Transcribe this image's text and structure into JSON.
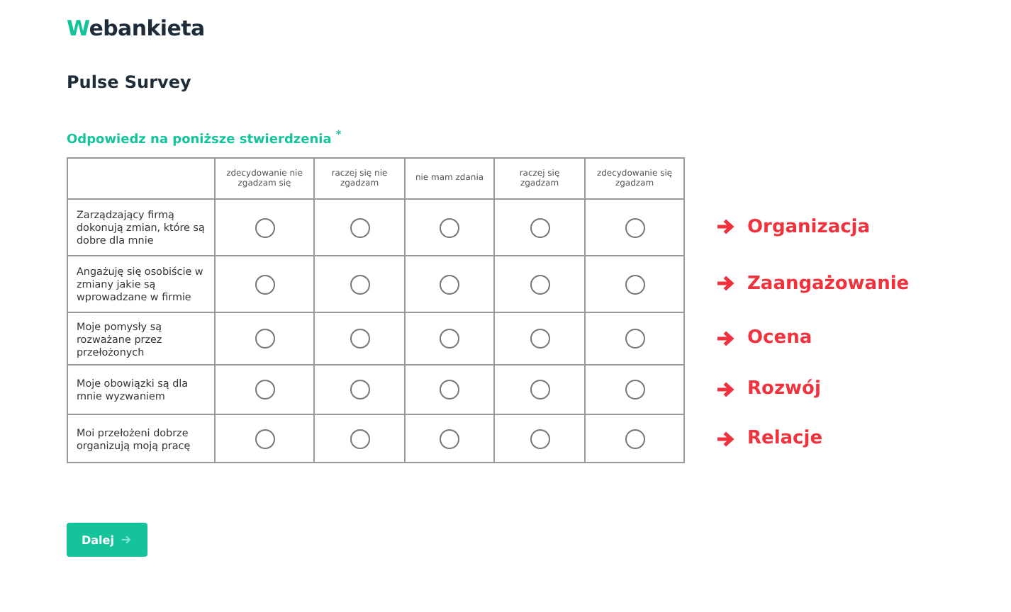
{
  "logo": "Webankieta",
  "title": "Pulse Survey",
  "question": {
    "text": "Odpowiedz na poniższe stwierdzenia",
    "required_mark": "*"
  },
  "table": {
    "columns": [
      "zdecydowanie nie zgadzam się",
      "raczej się nie zgadzam",
      "nie mam zdania",
      "raczej się zgadzam",
      "zdecydowanie się zgadzam"
    ],
    "rows": [
      {
        "statement": "Zarządzający firmą dokonują zmian, które są dobre dla mnie",
        "category": "Organizacja",
        "options": [
          {
            "selected": false
          },
          {
            "selected": false
          },
          {
            "selected": false
          },
          {
            "selected": false
          },
          {
            "selected": false
          }
        ]
      },
      {
        "statement": "Angażuję się osobiście w zmiany jakie są wprowadzane w firmie",
        "category": "Zaangażowanie",
        "options": [
          {
            "selected": false
          },
          {
            "selected": false
          },
          {
            "selected": false
          },
          {
            "selected": false
          },
          {
            "selected": false
          }
        ]
      },
      {
        "statement": "Moje pomysły są rozważane przez przełożonych",
        "category": "Ocena",
        "options": [
          {
            "selected": false
          },
          {
            "selected": false
          },
          {
            "selected": false
          },
          {
            "selected": false
          },
          {
            "selected": false
          }
        ]
      },
      {
        "statement": "Moje obowiązki są dla mnie wyzwaniem",
        "category": "Rozwój",
        "options": [
          {
            "selected": false
          },
          {
            "selected": false
          },
          {
            "selected": false
          },
          {
            "selected": false
          },
          {
            "selected": false
          }
        ]
      },
      {
        "statement": "Moi przełożeni dobrze organizują moją pracę",
        "category": "Relacje",
        "options": [
          {
            "selected": false
          },
          {
            "selected": false
          },
          {
            "selected": false
          },
          {
            "selected": false
          },
          {
            "selected": false
          }
        ]
      }
    ]
  },
  "next_button": "Dalej"
}
